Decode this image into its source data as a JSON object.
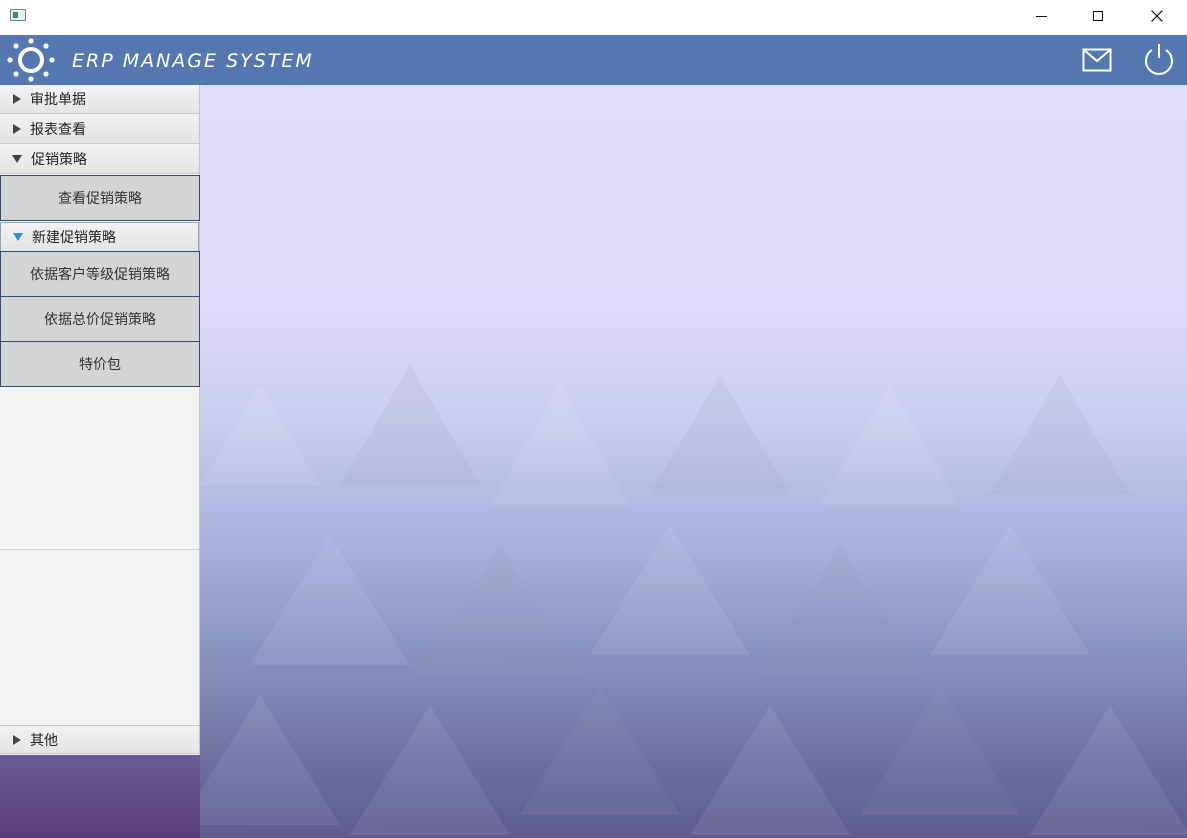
{
  "window": {
    "controls": [
      "minimize-icon",
      "maximize-icon",
      "close-icon"
    ]
  },
  "header": {
    "title": "ERP MANAGE SYSTEM",
    "logo_icon": "sun-icon",
    "mail_icon": "mail-icon",
    "power_icon": "power-icon",
    "bg_color": "#5577b0"
  },
  "sidebar": {
    "sections": [
      {
        "label": "审批单据",
        "expanded": false
      },
      {
        "label": "报表查看",
        "expanded": false
      },
      {
        "label": "促销策略",
        "expanded": true
      },
      {
        "label": "其他",
        "expanded": false
      }
    ],
    "promo": {
      "view_button": "查看促销策略",
      "new_header": "新建促销策略",
      "new_buttons": [
        "依据客户等级促销策略",
        "依据总价促销策略",
        "特价包"
      ]
    }
  }
}
